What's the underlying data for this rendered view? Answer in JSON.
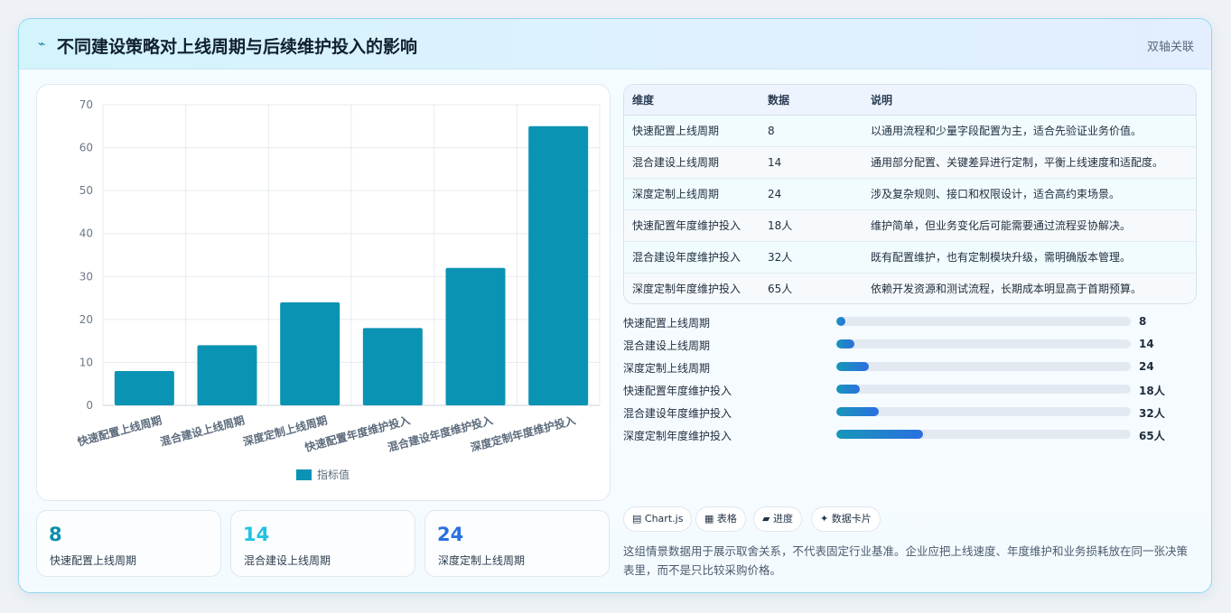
{
  "header": {
    "icon": "chart-line-icon",
    "title": "不同建设策略对上线周期与后续维护投入的影响",
    "badge": "双轴关联"
  },
  "colors": {
    "bar": "#0b93b3",
    "accent_blue": "#2b6fe0",
    "accent_teal": "#0b8fa8",
    "accent_cyan": "#22c3e0"
  },
  "chart_data": {
    "type": "bar",
    "categories": [
      "快速配置上线周期",
      "混合建设上线周期",
      "深度定制上线周期",
      "快速配置年度维护投入",
      "混合建设年度维护投入",
      "深度定制年度维护投入"
    ],
    "series": [
      {
        "name": "指标值",
        "values": [
          8,
          14,
          24,
          18,
          32,
          65
        ]
      }
    ],
    "ylim": [
      0,
      70
    ],
    "yticks": [
      "0",
      "10",
      "20",
      "30",
      "40",
      "50",
      "60",
      "70"
    ],
    "grid": true,
    "legend": "bottom"
  },
  "kpis": [
    {
      "value": "8",
      "label": "快速配置上线周期",
      "color": "#0b8fa8"
    },
    {
      "value": "14",
      "label": "混合建设上线周期",
      "color": "#22c3e0"
    },
    {
      "value": "24",
      "label": "深度定制上线周期",
      "color": "#2b6fe0"
    }
  ],
  "table": {
    "headers": [
      "维度",
      "数据",
      "说明"
    ],
    "rows": [
      [
        "快速配置上线周期",
        "8",
        "以通用流程和少量字段配置为主，适合先验证业务价值。"
      ],
      [
        "混合建设上线周期",
        "14",
        "通用部分配置、关键差异进行定制，平衡上线速度和适配度。"
      ],
      [
        "深度定制上线周期",
        "24",
        "涉及复杂规则、接口和权限设计，适合高约束场景。"
      ],
      [
        "快速配置年度维护投入",
        "18人",
        "维护简单，但业务变化后可能需要通过流程妥协解决。"
      ],
      [
        "混合建设年度维护投入",
        "32人",
        "既有配置维护，也有定制模块升级，需明确版本管理。"
      ],
      [
        "深度定制年度维护投入",
        "65人",
        "依赖开发资源和测试流程，长期成本明显高于首期预算。"
      ]
    ]
  },
  "progress": [
    {
      "label": "快速配置上线周期",
      "value": "8",
      "fraction": 0.03
    },
    {
      "label": "混合建设上线周期",
      "value": "14",
      "fraction": 0.06
    },
    {
      "label": "深度定制上线周期",
      "value": "24",
      "fraction": 0.11
    },
    {
      "label": "快速配置年度维护投入",
      "value": "18人",
      "fraction": 0.08
    },
    {
      "label": "混合建设年度维护投入",
      "value": "32人",
      "fraction": 0.145
    },
    {
      "label": "深度定制年度维护投入",
      "value": "65人",
      "fraction": 0.295
    }
  ],
  "tags": [
    {
      "icon": "▤",
      "label": "Chart.js"
    },
    {
      "icon": "▦",
      "label": "表格"
    },
    {
      "icon": "▰",
      "label": "进度"
    },
    {
      "icon": "✦",
      "label": "数据卡片"
    }
  ],
  "note": "这组情景数据用于展示取舍关系，不代表固定行业基准。企业应把上线速度、年度维护和业务损耗放在同一张决策表里，而不是只比较采购价格。"
}
